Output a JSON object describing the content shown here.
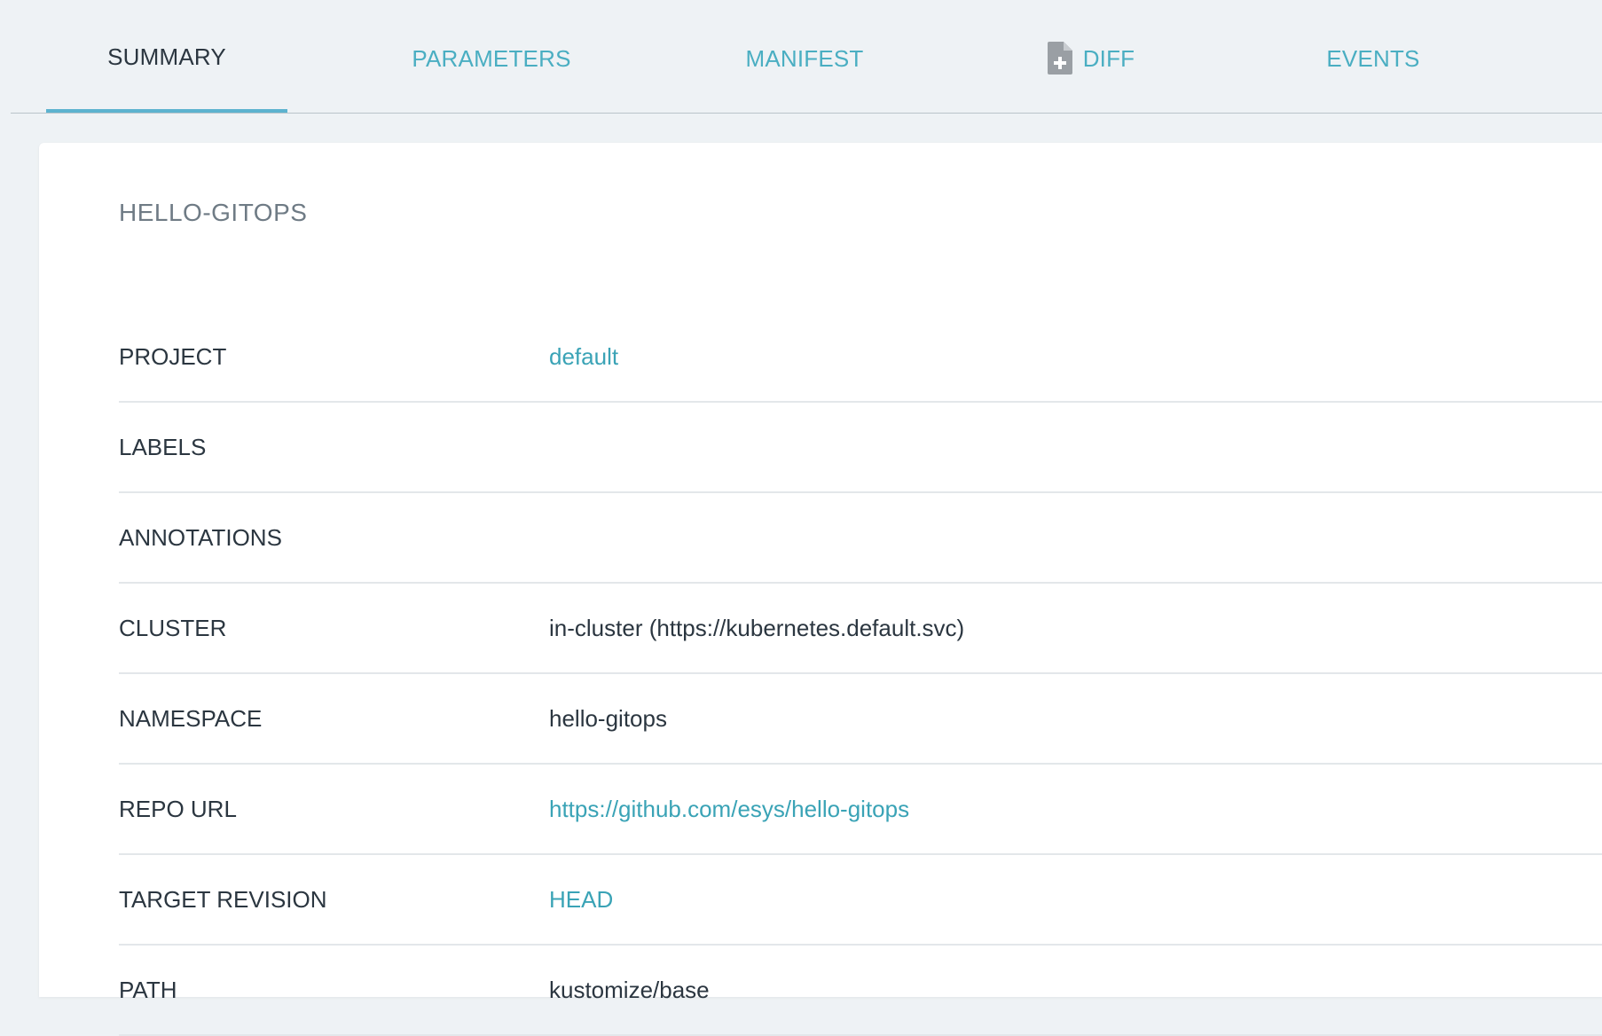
{
  "tabs": [
    {
      "label": "SUMMARY",
      "active": true
    },
    {
      "label": "PARAMETERS",
      "active": false
    },
    {
      "label": "MANIFEST",
      "active": false
    },
    {
      "label": "DIFF",
      "active": false,
      "icon": "file-plus-icon"
    },
    {
      "label": "EVENTS",
      "active": false
    }
  ],
  "summary": {
    "app_name": "HELLO-GITOPS",
    "rows": [
      {
        "label": "PROJECT",
        "value": "default"
      },
      {
        "label": "LABELS",
        "value": ""
      },
      {
        "label": "ANNOTATIONS",
        "value": ""
      },
      {
        "label": "CLUSTER",
        "value": "in-cluster (https://kubernetes.default.svc)"
      },
      {
        "label": "NAMESPACE",
        "value": "hello-gitops"
      },
      {
        "label": "REPO URL",
        "value": "https://github.com/esys/hello-gitops"
      },
      {
        "label": "TARGET REVISION",
        "value": "HEAD"
      },
      {
        "label": "PATH",
        "value": "kustomize/base"
      }
    ]
  },
  "colors": {
    "background": "#eef2f5",
    "accent": "#4aaec2",
    "link": "#3aa3b6",
    "text": "#2b3640",
    "muted": "#6f7b85",
    "active_underline": "#5cb3cf",
    "icon_gray": "#9a9fa4"
  }
}
